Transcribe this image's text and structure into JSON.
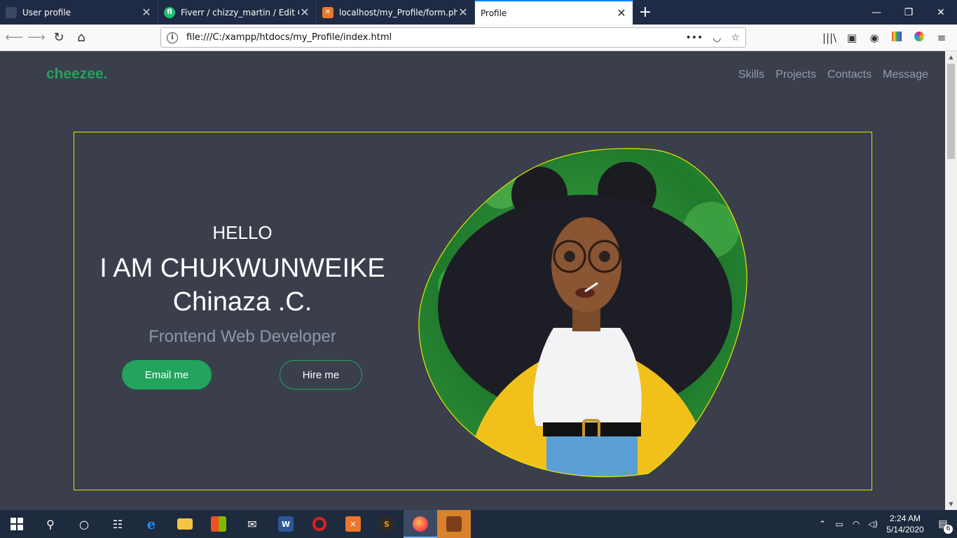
{
  "browser": {
    "tabs": [
      {
        "label": "User profile",
        "icon": "page-icon",
        "icon_color": "#1f2a44"
      },
      {
        "label": "Fiverr / chizzy_martin / Edit Gig",
        "icon": "fiverr-icon",
        "icon_color": "#1dbf73",
        "icon_text": "fi"
      },
      {
        "label": "localhost/my_Profile/form.php",
        "icon": "xampp-icon",
        "icon_color": "#e9782d",
        "icon_text": "✕"
      },
      {
        "label": "Profile",
        "icon": "page-icon",
        "icon_color": "#ffffff",
        "active": true
      }
    ],
    "new_tab": "+",
    "url": "file:///C:/xampp/htdocs/my_Profile/index.html",
    "window_controls": {
      "minimize": "—",
      "restore": "❐",
      "close": "✕"
    }
  },
  "site": {
    "logo": "cheezee.",
    "nav": [
      "Skills",
      "Projects",
      "Contacts",
      "Message"
    ],
    "hero": {
      "greeting": "HELLO",
      "name_line1": "I AM CHUKWUNWEIKE",
      "name_line2": "Chinaza .C.",
      "role": "Frontend Web Developer",
      "email_button": "Email me",
      "hire_button": "Hire me"
    },
    "colors": {
      "brand": "#22a45d",
      "background": "#3a3f4b",
      "border": "#e6e600",
      "muted": "#8b98ad"
    }
  },
  "taskbar": {
    "time": "2:24 AM",
    "date": "5/14/2020",
    "notifications": "6"
  }
}
